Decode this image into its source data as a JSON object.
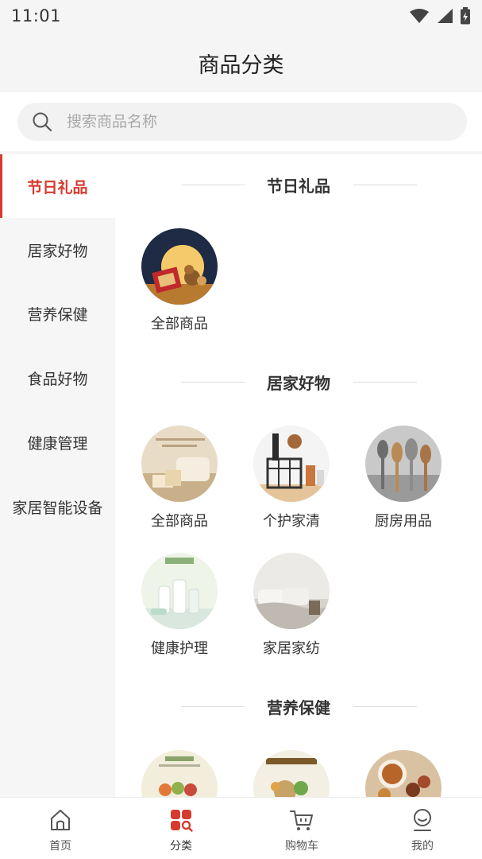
{
  "status_bar": {
    "time": "11:01"
  },
  "header": {
    "title": "商品分类"
  },
  "search": {
    "placeholder": "搜索商品名称"
  },
  "sidebar": {
    "items": [
      {
        "label": "节日礼品",
        "active": true
      },
      {
        "label": "居家好物",
        "active": false
      },
      {
        "label": "营养保健",
        "active": false
      },
      {
        "label": "食品好物",
        "active": false
      },
      {
        "label": "健康管理",
        "active": false
      },
      {
        "label": "家居智能设备",
        "active": false
      }
    ]
  },
  "sections": [
    {
      "title": "节日礼品",
      "items": [
        {
          "label": "全部商品",
          "icon": "mooncake-gift-box-image"
        }
      ]
    },
    {
      "title": "居家好物",
      "items": [
        {
          "label": "全部商品",
          "icon": "home-goods-image"
        },
        {
          "label": "个护家清",
          "icon": "personal-care-image"
        },
        {
          "label": "厨房用品",
          "icon": "kitchen-utensils-image"
        },
        {
          "label": "健康护理",
          "icon": "health-care-image"
        },
        {
          "label": "家居家纺",
          "icon": "bedding-image"
        }
      ]
    },
    {
      "title": "营养保健",
      "items": [
        {
          "label": "",
          "icon": "nutrition-image"
        },
        {
          "label": "",
          "icon": "supplement-image"
        },
        {
          "label": "",
          "icon": "dried-fruit-image"
        }
      ]
    }
  ],
  "tab_bar": {
    "items": [
      {
        "label": "首页",
        "icon": "home-icon",
        "active": false
      },
      {
        "label": "分类",
        "icon": "category-icon",
        "active": true
      },
      {
        "label": "购物车",
        "icon": "cart-icon",
        "active": false
      },
      {
        "label": "我的",
        "icon": "profile-icon",
        "active": false
      }
    ]
  },
  "colors": {
    "accent": "#d63b2f",
    "sidebar_bg": "#f6f6f6",
    "header_bg": "#f5f5f5"
  }
}
